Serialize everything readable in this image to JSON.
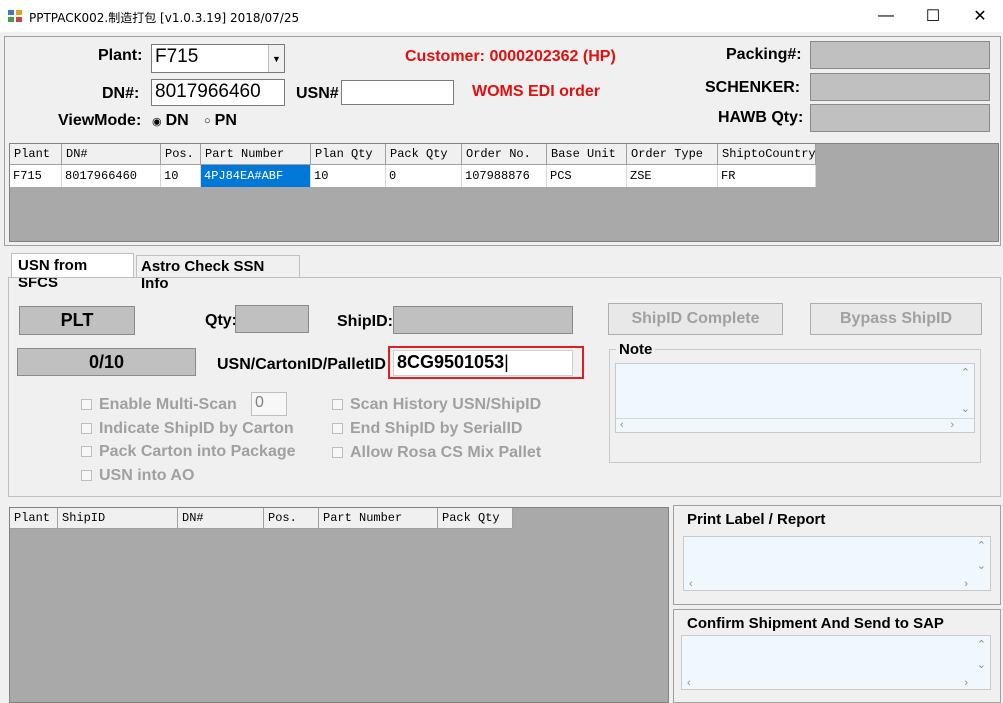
{
  "window": {
    "title": "PPTPACK002.制造打包 [v1.0.3.19] 2018/07/25",
    "min_glyph": "—",
    "max_glyph": "☐",
    "close_glyph": "✕"
  },
  "header": {
    "plant_label": "Plant:",
    "plant_value": "F715",
    "customer_text": "Customer: 0000202362 (HP)",
    "dn_label": "DN#:",
    "dn_value": "8017966460",
    "usn_label": "USN#",
    "usn_value": "",
    "woms_text": "WOMS EDI order",
    "viewmode_label": "ViewMode:",
    "viewmode_options": [
      "DN",
      "PN"
    ],
    "viewmode_selected": "DN",
    "packing_label": "Packing#:",
    "schenker_label": "SCHENKER:",
    "hawb_label": "HAWB Qty:",
    "customer_color": "#e01010",
    "woms_color": "#e01010"
  },
  "dn_grid": {
    "columns": [
      "Plant",
      "DN#",
      "Pos.",
      "Part Number",
      "Plan Qty",
      "Pack Qty",
      "Order No.",
      "Base Unit",
      "Order Type",
      "ShiptoCountry"
    ],
    "rows": [
      [
        "F715",
        "8017966460",
        "10",
        "4PJ84EA#ABF",
        "10",
        "0",
        "107988876",
        "PCS",
        "ZSE",
        "FR"
      ]
    ],
    "selected_color": "#0078d7"
  },
  "tabs": [
    {
      "label": "USN from SFCS",
      "active": true
    },
    {
      "label": "Astro Check SSN Info",
      "active": false
    }
  ],
  "scan": {
    "plt_label": "PLT",
    "count": "0/10",
    "qty_label": "Qty:",
    "shipid_label": "ShipID:",
    "usn_carton_label": "USN/CartonID/PalletID",
    "usn_carton_value": "8CG9501053",
    "shipid_complete_label": "ShipID Complete",
    "bypass_shipid_label": "Bypass ShipID",
    "note_label": "Note",
    "multi_scan_value": "0",
    "highlight_color": "#e02020",
    "options_left": [
      "Enable Multi-Scan",
      "Indicate ShipID by Carton",
      "Pack Carton into Package",
      "USN into AO"
    ],
    "options_right": [
      "Scan History USN/ShipID",
      "End ShipID by SerialID",
      "Allow Rosa CS Mix Pallet"
    ]
  },
  "ship_grid": {
    "columns": [
      "Plant",
      "ShipID",
      "DN#",
      "Pos.",
      "Part Number",
      "Pack Qty"
    ]
  },
  "print_group": {
    "label": "Print Label / Report"
  },
  "confirm_group": {
    "label": "Confirm Shipment And Send to SAP"
  }
}
